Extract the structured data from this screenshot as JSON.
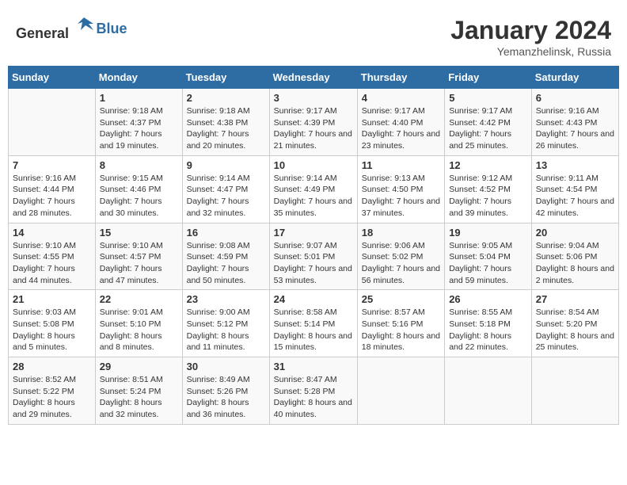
{
  "header": {
    "logo_general": "General",
    "logo_blue": "Blue",
    "month_title": "January 2024",
    "subtitle": "Yemanzhelinsk, Russia"
  },
  "days_of_week": [
    "Sunday",
    "Monday",
    "Tuesday",
    "Wednesday",
    "Thursday",
    "Friday",
    "Saturday"
  ],
  "weeks": [
    [
      {
        "day": "",
        "sunrise": "",
        "sunset": "",
        "daylight": ""
      },
      {
        "day": "1",
        "sunrise": "Sunrise: 9:18 AM",
        "sunset": "Sunset: 4:37 PM",
        "daylight": "Daylight: 7 hours and 19 minutes."
      },
      {
        "day": "2",
        "sunrise": "Sunrise: 9:18 AM",
        "sunset": "Sunset: 4:38 PM",
        "daylight": "Daylight: 7 hours and 20 minutes."
      },
      {
        "day": "3",
        "sunrise": "Sunrise: 9:17 AM",
        "sunset": "Sunset: 4:39 PM",
        "daylight": "Daylight: 7 hours and 21 minutes."
      },
      {
        "day": "4",
        "sunrise": "Sunrise: 9:17 AM",
        "sunset": "Sunset: 4:40 PM",
        "daylight": "Daylight: 7 hours and 23 minutes."
      },
      {
        "day": "5",
        "sunrise": "Sunrise: 9:17 AM",
        "sunset": "Sunset: 4:42 PM",
        "daylight": "Daylight: 7 hours and 25 minutes."
      },
      {
        "day": "6",
        "sunrise": "Sunrise: 9:16 AM",
        "sunset": "Sunset: 4:43 PM",
        "daylight": "Daylight: 7 hours and 26 minutes."
      }
    ],
    [
      {
        "day": "7",
        "sunrise": "Sunrise: 9:16 AM",
        "sunset": "Sunset: 4:44 PM",
        "daylight": "Daylight: 7 hours and 28 minutes."
      },
      {
        "day": "8",
        "sunrise": "Sunrise: 9:15 AM",
        "sunset": "Sunset: 4:46 PM",
        "daylight": "Daylight: 7 hours and 30 minutes."
      },
      {
        "day": "9",
        "sunrise": "Sunrise: 9:14 AM",
        "sunset": "Sunset: 4:47 PM",
        "daylight": "Daylight: 7 hours and 32 minutes."
      },
      {
        "day": "10",
        "sunrise": "Sunrise: 9:14 AM",
        "sunset": "Sunset: 4:49 PM",
        "daylight": "Daylight: 7 hours and 35 minutes."
      },
      {
        "day": "11",
        "sunrise": "Sunrise: 9:13 AM",
        "sunset": "Sunset: 4:50 PM",
        "daylight": "Daylight: 7 hours and 37 minutes."
      },
      {
        "day": "12",
        "sunrise": "Sunrise: 9:12 AM",
        "sunset": "Sunset: 4:52 PM",
        "daylight": "Daylight: 7 hours and 39 minutes."
      },
      {
        "day": "13",
        "sunrise": "Sunrise: 9:11 AM",
        "sunset": "Sunset: 4:54 PM",
        "daylight": "Daylight: 7 hours and 42 minutes."
      }
    ],
    [
      {
        "day": "14",
        "sunrise": "Sunrise: 9:10 AM",
        "sunset": "Sunset: 4:55 PM",
        "daylight": "Daylight: 7 hours and 44 minutes."
      },
      {
        "day": "15",
        "sunrise": "Sunrise: 9:10 AM",
        "sunset": "Sunset: 4:57 PM",
        "daylight": "Daylight: 7 hours and 47 minutes."
      },
      {
        "day": "16",
        "sunrise": "Sunrise: 9:08 AM",
        "sunset": "Sunset: 4:59 PM",
        "daylight": "Daylight: 7 hours and 50 minutes."
      },
      {
        "day": "17",
        "sunrise": "Sunrise: 9:07 AM",
        "sunset": "Sunset: 5:01 PM",
        "daylight": "Daylight: 7 hours and 53 minutes."
      },
      {
        "day": "18",
        "sunrise": "Sunrise: 9:06 AM",
        "sunset": "Sunset: 5:02 PM",
        "daylight": "Daylight: 7 hours and 56 minutes."
      },
      {
        "day": "19",
        "sunrise": "Sunrise: 9:05 AM",
        "sunset": "Sunset: 5:04 PM",
        "daylight": "Daylight: 7 hours and 59 minutes."
      },
      {
        "day": "20",
        "sunrise": "Sunrise: 9:04 AM",
        "sunset": "Sunset: 5:06 PM",
        "daylight": "Daylight: 8 hours and 2 minutes."
      }
    ],
    [
      {
        "day": "21",
        "sunrise": "Sunrise: 9:03 AM",
        "sunset": "Sunset: 5:08 PM",
        "daylight": "Daylight: 8 hours and 5 minutes."
      },
      {
        "day": "22",
        "sunrise": "Sunrise: 9:01 AM",
        "sunset": "Sunset: 5:10 PM",
        "daylight": "Daylight: 8 hours and 8 minutes."
      },
      {
        "day": "23",
        "sunrise": "Sunrise: 9:00 AM",
        "sunset": "Sunset: 5:12 PM",
        "daylight": "Daylight: 8 hours and 11 minutes."
      },
      {
        "day": "24",
        "sunrise": "Sunrise: 8:58 AM",
        "sunset": "Sunset: 5:14 PM",
        "daylight": "Daylight: 8 hours and 15 minutes."
      },
      {
        "day": "25",
        "sunrise": "Sunrise: 8:57 AM",
        "sunset": "Sunset: 5:16 PM",
        "daylight": "Daylight: 8 hours and 18 minutes."
      },
      {
        "day": "26",
        "sunrise": "Sunrise: 8:55 AM",
        "sunset": "Sunset: 5:18 PM",
        "daylight": "Daylight: 8 hours and 22 minutes."
      },
      {
        "day": "27",
        "sunrise": "Sunrise: 8:54 AM",
        "sunset": "Sunset: 5:20 PM",
        "daylight": "Daylight: 8 hours and 25 minutes."
      }
    ],
    [
      {
        "day": "28",
        "sunrise": "Sunrise: 8:52 AM",
        "sunset": "Sunset: 5:22 PM",
        "daylight": "Daylight: 8 hours and 29 minutes."
      },
      {
        "day": "29",
        "sunrise": "Sunrise: 8:51 AM",
        "sunset": "Sunset: 5:24 PM",
        "daylight": "Daylight: 8 hours and 32 minutes."
      },
      {
        "day": "30",
        "sunrise": "Sunrise: 8:49 AM",
        "sunset": "Sunset: 5:26 PM",
        "daylight": "Daylight: 8 hours and 36 minutes."
      },
      {
        "day": "31",
        "sunrise": "Sunrise: 8:47 AM",
        "sunset": "Sunset: 5:28 PM",
        "daylight": "Daylight: 8 hours and 40 minutes."
      },
      {
        "day": "",
        "sunrise": "",
        "sunset": "",
        "daylight": ""
      },
      {
        "day": "",
        "sunrise": "",
        "sunset": "",
        "daylight": ""
      },
      {
        "day": "",
        "sunrise": "",
        "sunset": "",
        "daylight": ""
      }
    ]
  ]
}
